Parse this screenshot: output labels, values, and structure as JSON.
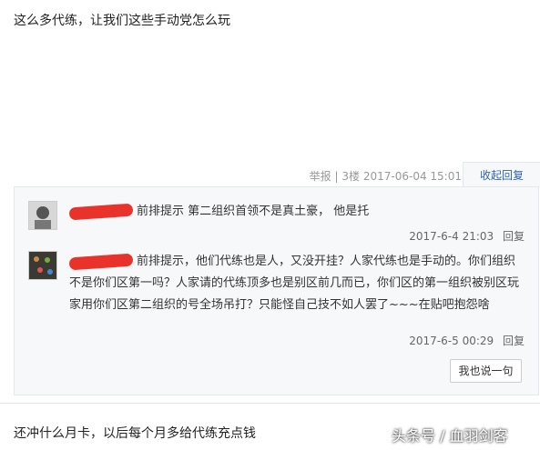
{
  "post1": {
    "text": "这么多代练，让我们这些手动党怎么玩",
    "report": "举报",
    "floor": "3楼",
    "datetime": "2017-06-04 15:01",
    "collapse": "收起回复"
  },
  "replies": [
    {
      "text": "前排提示 第二组织首领不是真土豪， 他是托",
      "date": "2017-6-4 21:03",
      "reply_label": "回复"
    },
    {
      "text": "前排提示，他们代练也是人，又没开挂？人家代练也是手动的。你们组织不是你们区第一吗？人家请的代练顶多也是别区前几而已，你们区的第一组织被别区玩家用你们区第二组织的号全场吊打？只能怪自己技不如人罢了~~~在贴吧抱怨啥",
      "date": "2017-6-5 00:29",
      "reply_label": "回复"
    }
  ],
  "say_button": "我也说一句",
  "post2": {
    "text": "还冲什么月卡，以后每个月多给代练充点钱"
  },
  "watermark": "头条号 / 血羽剑客"
}
